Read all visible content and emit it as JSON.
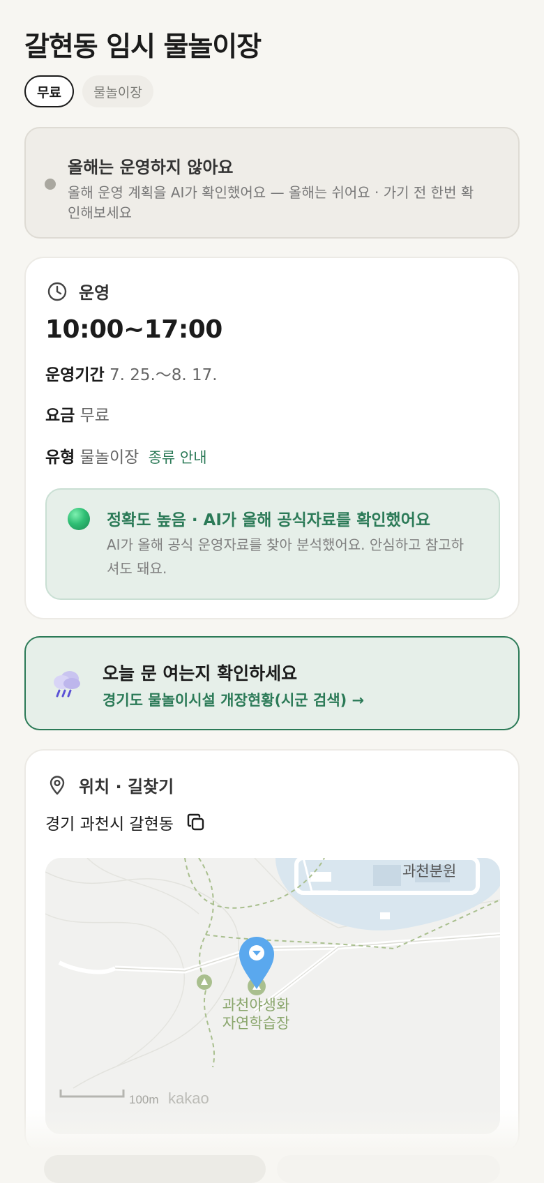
{
  "header": {
    "title": "갈현동 임시 물놀이장"
  },
  "chips": [
    {
      "label": "무료",
      "active": true
    },
    {
      "label": "물놀이장",
      "active": false
    }
  ],
  "status": {
    "title": "올해는 운영하지 않아요",
    "description": "올해 운영 계획을 AI가 확인했어요 — 올해는 쉬어요 · 가기 전 한번 확인해보세요",
    "dot_color": "#a9a79f"
  },
  "operation": {
    "section_label": "운영",
    "icon": "clock-icon",
    "hours": "10:00~17:00",
    "period_label": "운영기간",
    "period_value": "7. 25.〜8. 17.",
    "fee_label": "요금",
    "fee_value": "무료",
    "type_label": "유형",
    "type_value": "물놀이장",
    "type_link": "종류 안내",
    "accuracy_title": "정확도 높음 · AI가 올해 공식자료를 확인했어요",
    "accuracy_desc": "AI가 올해 공식 운영자료를 찾아 분석했어요. 안심하고 참고하셔도 돼요."
  },
  "notice": {
    "icon": "rain-cloud-icon",
    "title": "오늘 문 여는지 확인하세요",
    "link_label": "경기도 물놀이시설 개장현황(시군 검색) →"
  },
  "location": {
    "section_label": "위치 · 길찾기",
    "icon": "location-pin-icon",
    "address": "경기 과천시 갈현동",
    "copy_icon": "copy-icon",
    "map": {
      "place_label_line1": "과천야생화",
      "place_label_line2": "자연학습장",
      "top_label": "과천분원",
      "scale_label": "100m",
      "brand": "kakao"
    }
  },
  "colors": {
    "accent_green": "#2b7a57",
    "background": "#f7f6f2",
    "marker_blue": "#5aa8ee"
  }
}
